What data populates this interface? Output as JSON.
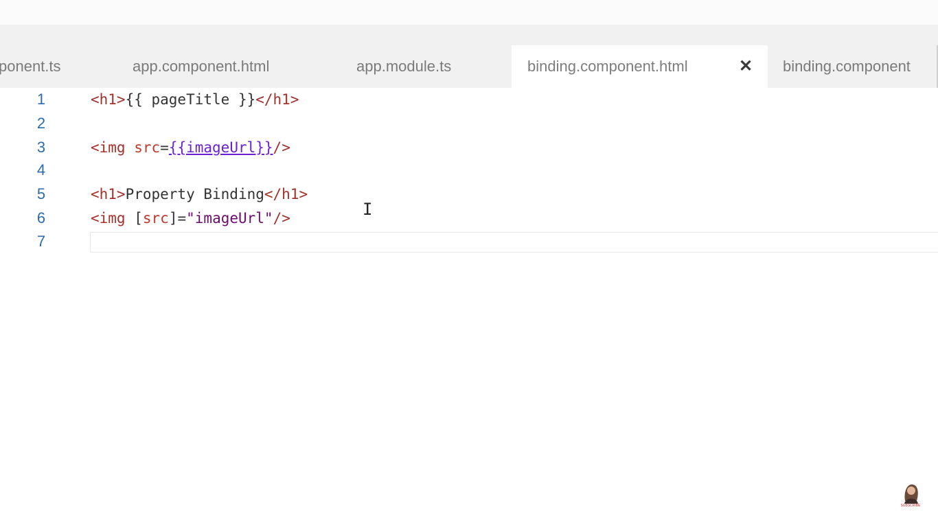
{
  "tabs": [
    {
      "label": "ponent.ts",
      "active": false
    },
    {
      "label": "app.component.html",
      "active": false
    },
    {
      "label": "app.module.ts",
      "active": false
    },
    {
      "label": "binding.component.html",
      "active": true
    },
    {
      "label": "binding.component",
      "active": false
    }
  ],
  "editor": {
    "line_numbers": [
      "1",
      "2",
      "3",
      "4",
      "5",
      "6",
      "7"
    ],
    "lines": {
      "l1": {
        "open": "<h1>",
        "text": "{{ pageTitle }}",
        "close": "</h1>"
      },
      "l3": {
        "open": "<img",
        "sp": " ",
        "attr": "src",
        "eq": "=",
        "interp": "{{imageUrl}}",
        "end": "/>"
      },
      "l5": {
        "open": "<h1>",
        "text": "Property Binding",
        "close": "</h1>"
      },
      "l6": {
        "open": "<img",
        "sp": " ",
        "bo": "[",
        "attr": "src",
        "bc": "]",
        "eq": "=",
        "val": "\"imageUrl\"",
        "end": "/>"
      }
    }
  },
  "icons": {
    "close": "close-icon",
    "cursor": "text-cursor-icon",
    "avatar": "subscribe-avatar-icon"
  },
  "badge": {
    "label": "SUBSCRIBE"
  },
  "colors": {
    "tab_bar": "#f1f1f1",
    "active_tab": "#ffffff",
    "line_number": "#2b6cb0",
    "tag": "#a5302a",
    "attribute": "#c0392b",
    "string": "#6d0a6f",
    "interpolation": "#6b1fd6"
  }
}
